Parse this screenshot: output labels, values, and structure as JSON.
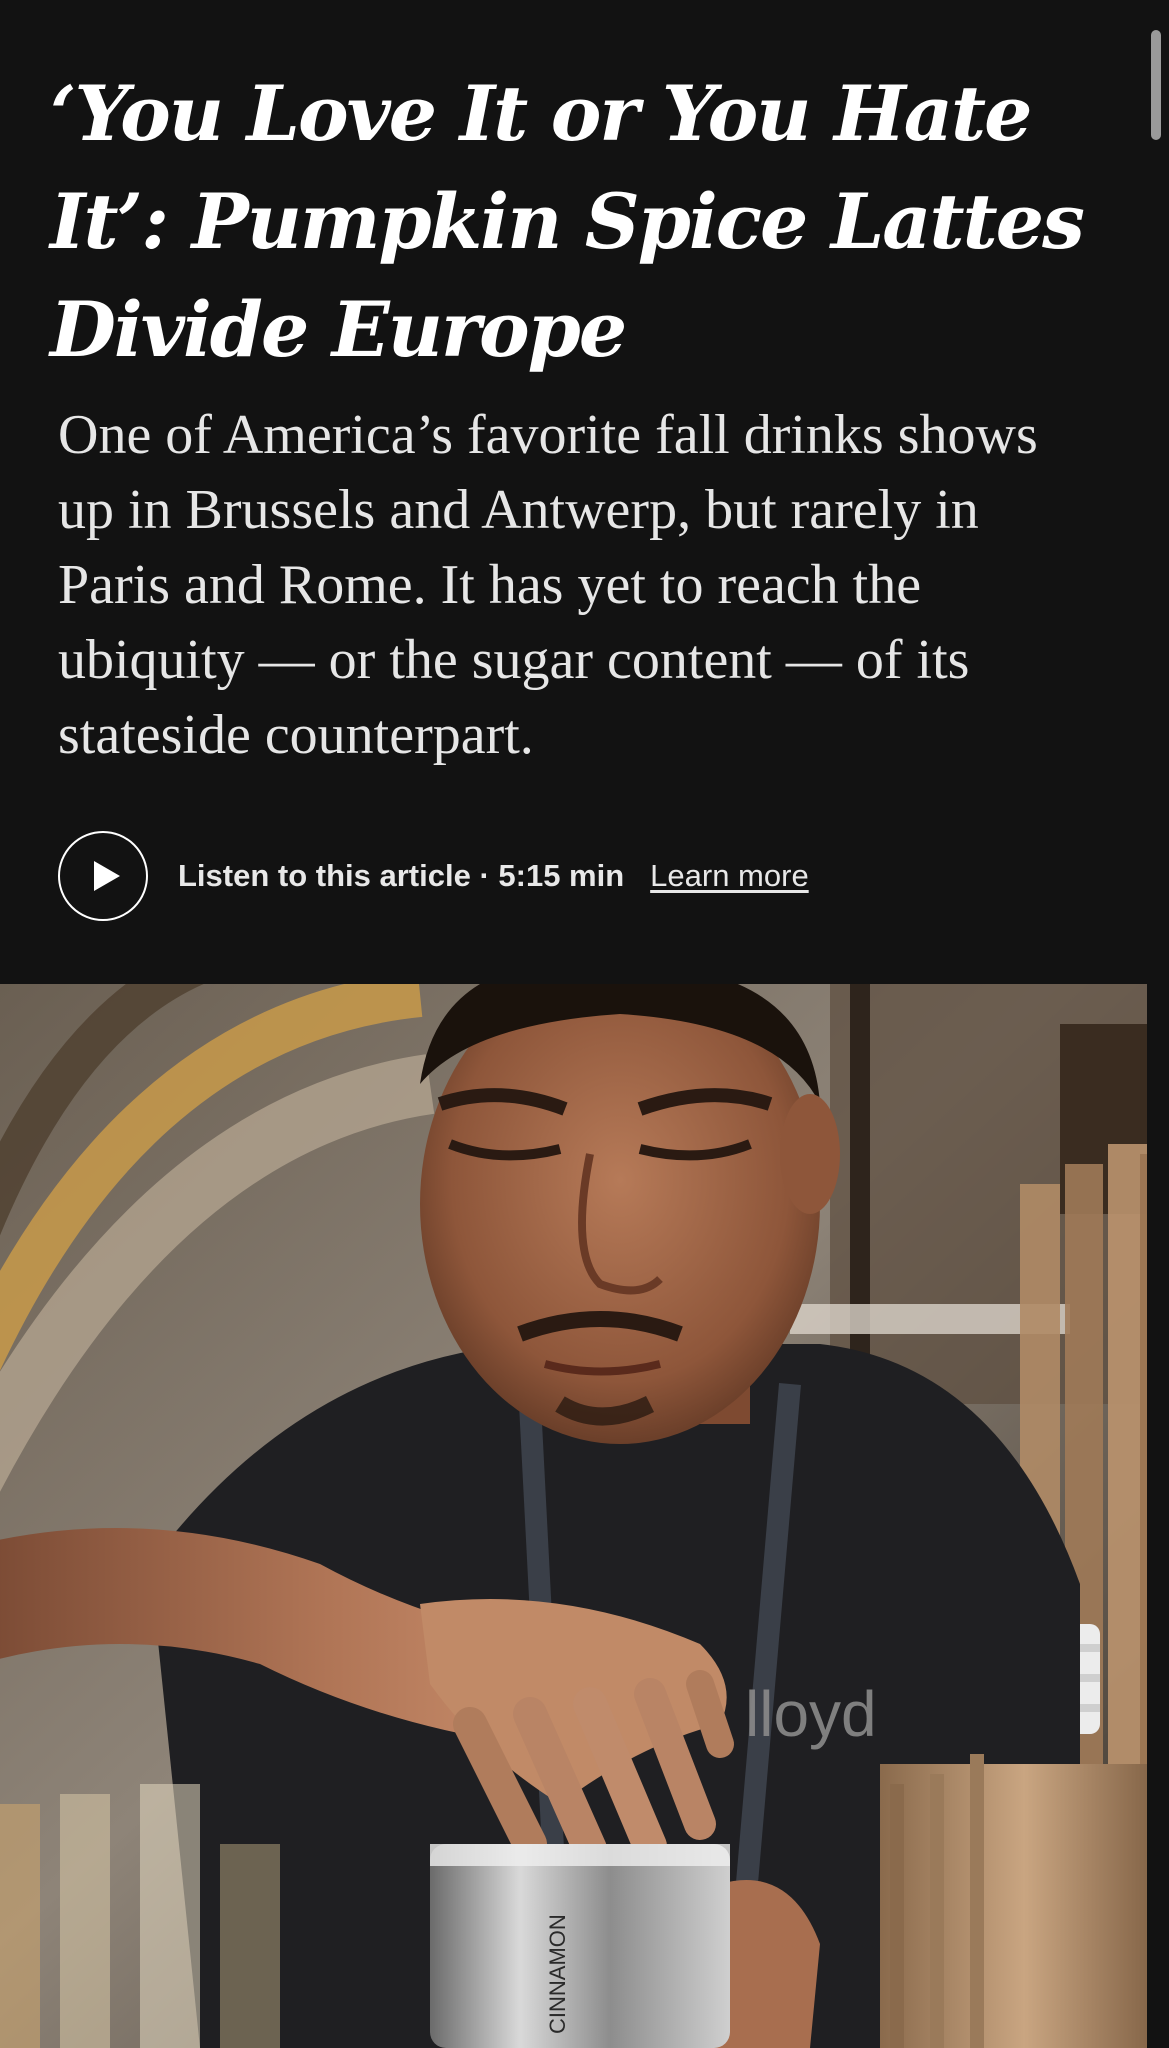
{
  "article": {
    "headline": "‘You Love It or You Hate It’: Pumpkin Spice Lattes Divide Europe",
    "summary": "One of America’s favorite fall drinks shows up in Brussels and Antwerp, but rarely in Paris and Rome. It has yet to reach the ubiquity — or the sugar content — of its stateside counterpart."
  },
  "audio": {
    "play_icon": "play-icon",
    "listen_label": "Listen to this article · 5:15 min",
    "learn_more_label": "Learn more"
  },
  "hero_image": {
    "shaker_label": "CINNAMON",
    "shirt_text": "lloyd"
  },
  "colors": {
    "background": "#121212",
    "text": "#ffffff",
    "summary_text": "#e6e6e6"
  }
}
